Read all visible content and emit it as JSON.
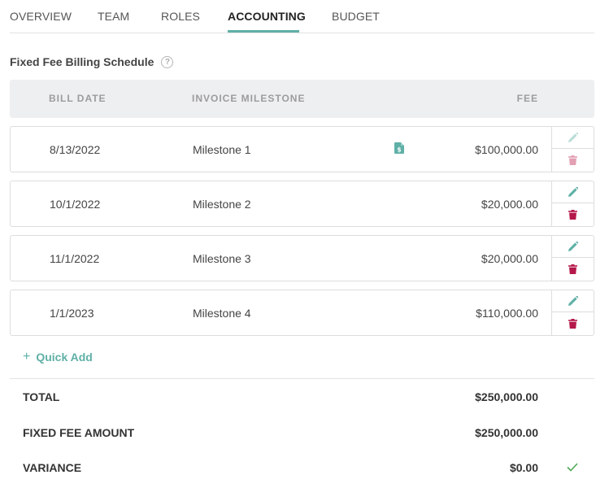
{
  "tabs": [
    {
      "label": "OVERVIEW",
      "active": false
    },
    {
      "label": "TEAM",
      "active": false
    },
    {
      "label": "ROLES",
      "active": false
    },
    {
      "label": "ACCOUNTING",
      "active": true
    },
    {
      "label": "BUDGET",
      "active": false
    }
  ],
  "section": {
    "title": "Fixed Fee Billing Schedule",
    "help_icon": "question-circle-icon"
  },
  "table": {
    "headers": {
      "bill_date": "BILL DATE",
      "milestone": "INVOICE MILESTONE",
      "fee": "FEE"
    },
    "rows": [
      {
        "bill_date": "8/13/2022",
        "milestone": "Milestone 1",
        "fee": "$100,000.00",
        "has_invoice_doc": true,
        "actions_enabled": false
      },
      {
        "bill_date": "10/1/2022",
        "milestone": "Milestone 2",
        "fee": "$20,000.00",
        "has_invoice_doc": false,
        "actions_enabled": true
      },
      {
        "bill_date": "11/1/2022",
        "milestone": "Milestone 3",
        "fee": "$20,000.00",
        "has_invoice_doc": false,
        "actions_enabled": true
      },
      {
        "bill_date": "1/1/2023",
        "milestone": "Milestone 4",
        "fee": "$110,000.00",
        "has_invoice_doc": false,
        "actions_enabled": true
      }
    ]
  },
  "quick_add": {
    "label": "Quick Add",
    "icon": "plus-icon"
  },
  "summary": {
    "total_label": "TOTAL",
    "total_value": "$250,000.00",
    "fixed_fee_label": "FIXED FEE AMOUNT",
    "fixed_fee_value": "$250,000.00",
    "variance_label": "VARIANCE",
    "variance_value": "$0.00",
    "variance_icon": "check-icon"
  },
  "colors": {
    "accent": "#5fb0a6",
    "delete": "#b5184a",
    "delete_disabled": "#e3a0b3",
    "edit_disabled": "#bcdcd7",
    "check": "#4fa855",
    "header_bg": "#eeeff1"
  }
}
